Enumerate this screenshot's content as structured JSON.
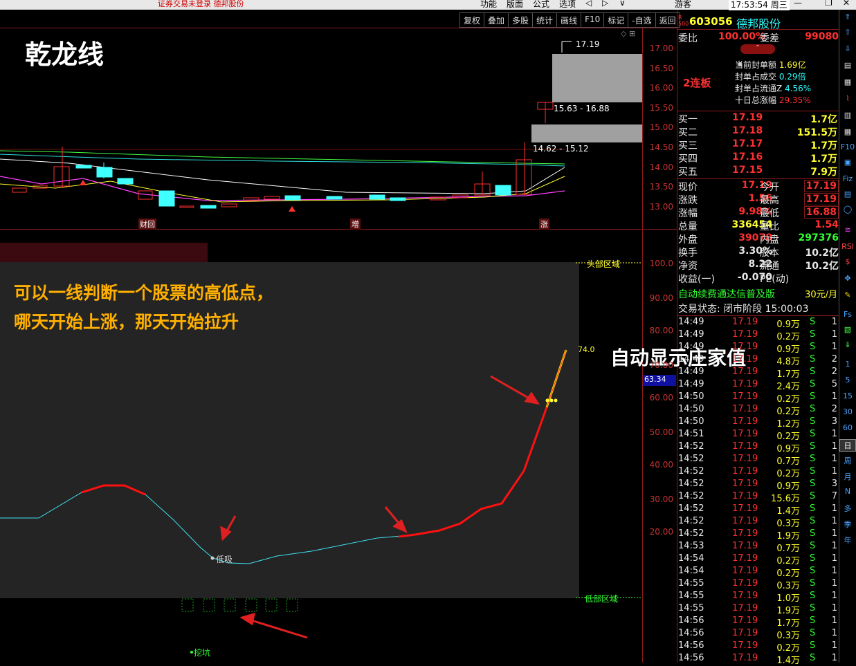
{
  "topbar": {
    "warning": "证券交易未登录  德邦股份",
    "menu": [
      "功能",
      "版面",
      "公式",
      "选项"
    ],
    "user": "游客",
    "clock": "17:53:54 周三"
  },
  "toolbar": [
    "复权",
    "叠加",
    "多股",
    "统计",
    "画线",
    "F10",
    "标记",
    "-自选",
    "返回"
  ],
  "stock": {
    "code": "603056",
    "name": "德邦股份",
    "badge": "R\n500"
  },
  "chart": {
    "title": "乾龙线",
    "price_axis": [
      "17.00",
      "16.50",
      "16.00",
      "15.50",
      "15.00",
      "14.50",
      "14.00",
      "13.50",
      "13.00"
    ],
    "annotations": {
      "top_label": "17.19",
      "box1": "15.63 - 16.88",
      "box2": "14.62 - 15.12"
    },
    "events": [
      "财回",
      "增",
      "涨"
    ]
  },
  "indicator": {
    "axis": [
      "100.0",
      "90.00",
      "80.00",
      "70.00",
      "60.00",
      "50.00",
      "40.00",
      "30.00",
      "20.00"
    ],
    "top_zone": "头部区域",
    "bottom_zone": "低部区域",
    "value_tag": "63.34",
    "val_74": "74.0",
    "low_buy": "低吸",
    "dig": "挖坑",
    "promo_line1": "可以一线判断一个股票的高低点，",
    "promo_line2": "哪天开始上涨，那天开始拉升",
    "banker_value": "自动显示庄家值"
  },
  "quote": {
    "webi": {
      "l1": "委比",
      "v1": "100.00%",
      "l2": "委差",
      "v2": "99080"
    },
    "limit_up": "2连板",
    "stats": [
      {
        "l": "当前封单额",
        "v": "1.69亿"
      },
      {
        "l": "封单占成交",
        "v": "0.29倍"
      },
      {
        "l": "封单占流通Z",
        "v": "4.56%"
      },
      {
        "l": "十日总涨幅",
        "v": "29.35%"
      }
    ],
    "bids": [
      {
        "l": "买一",
        "p": "17.19",
        "v": "1.7亿"
      },
      {
        "l": "买二",
        "p": "17.18",
        "v": "151.5万"
      },
      {
        "l": "买三",
        "p": "17.17",
        "v": "1.7万"
      },
      {
        "l": "买四",
        "p": "17.16",
        "v": "1.7万"
      },
      {
        "l": "买五",
        "p": "17.15",
        "v": "7.9万"
      }
    ],
    "info": [
      {
        "l1": "现价",
        "v1": "17.19",
        "l2": "今开",
        "v2": "17.19"
      },
      {
        "l1": "涨跌",
        "v1": "1.56",
        "l2": "最高",
        "v2": "17.19"
      },
      {
        "l1": "涨幅",
        "v1": "9.98%",
        "l2": "最低",
        "v2": "16.88"
      },
      {
        "l1": "总量",
        "v1": "336454",
        "l2": "量比",
        "v2": "1.54"
      },
      {
        "l1": "外盘",
        "v1": "39078",
        "l2": "内盘",
        "v2": "297376"
      },
      {
        "l1": "换手",
        "v1": "3.30%",
        "l2": "股本",
        "v2": "10.2亿"
      },
      {
        "l1": "净资",
        "v1": "8.22",
        "l2": "流通",
        "v2": "10.2亿"
      },
      {
        "l1": "收益(一)",
        "v1": "-0.070",
        "l2": "PE(动)",
        "v2": ""
      }
    ],
    "ad": "自动续费通达信普及版",
    "price": "30元/月",
    "status": "交易状态: 闭市阶段 15:00:03",
    "ticks": [
      [
        "14:49",
        "17.19",
        "0.9万",
        "S",
        "1"
      ],
      [
        "14:49",
        "17.19",
        "0.2万",
        "S",
        "1"
      ],
      [
        "14:49",
        "17.19",
        "0.9万",
        "S",
        "1"
      ],
      [
        "14:49",
        "17.19",
        "4.8万",
        "S",
        "2"
      ],
      [
        "14:49",
        "17.19",
        "1.7万",
        "S",
        "2"
      ],
      [
        "14:49",
        "17.19",
        "2.4万",
        "S",
        "5"
      ],
      [
        "14:50",
        "17.19",
        "0.2万",
        "S",
        "1"
      ],
      [
        "14:50",
        "17.19",
        "0.2万",
        "S",
        "2"
      ],
      [
        "14:50",
        "17.19",
        "1.2万",
        "S",
        "3"
      ],
      [
        "14:51",
        "17.19",
        "0.2万",
        "S",
        "1"
      ],
      [
        "14:52",
        "17.19",
        "0.9万",
        "S",
        "1"
      ],
      [
        "14:52",
        "17.19",
        "0.7万",
        "S",
        "1"
      ],
      [
        "14:52",
        "17.19",
        "0.2万",
        "S",
        "1"
      ],
      [
        "14:52",
        "17.19",
        "0.9万",
        "S",
        "3"
      ],
      [
        "14:52",
        "17.19",
        "15.6万",
        "S",
        "7"
      ],
      [
        "14:52",
        "17.19",
        "1.4万",
        "S",
        "1"
      ],
      [
        "14:52",
        "17.19",
        "0.3万",
        "S",
        "1"
      ],
      [
        "14:52",
        "17.19",
        "1.9万",
        "S",
        "1"
      ],
      [
        "14:53",
        "17.19",
        "0.7万",
        "S",
        "1"
      ],
      [
        "14:54",
        "17.19",
        "0.2万",
        "S",
        "1"
      ],
      [
        "14:54",
        "17.19",
        "0.2万",
        "S",
        "1"
      ],
      [
        "14:55",
        "17.19",
        "0.3万",
        "S",
        "1"
      ],
      [
        "14:55",
        "17.19",
        "1.0万",
        "S",
        "1"
      ],
      [
        "14:55",
        "17.19",
        "1.9万",
        "S",
        "1"
      ],
      [
        "14:56",
        "17.19",
        "1.7万",
        "S",
        "1"
      ],
      [
        "14:56",
        "17.19",
        "0.3万",
        "S",
        "1"
      ],
      [
        "14:56",
        "17.19",
        "0.2万",
        "S",
        "1"
      ],
      [
        "14:56",
        "17.19",
        "1.4万",
        "S",
        "1"
      ]
    ]
  },
  "sidebar": [
    "1",
    "5",
    "15",
    "30",
    "60",
    "日",
    "周",
    "月",
    "N",
    "多",
    "季",
    "年"
  ]
}
